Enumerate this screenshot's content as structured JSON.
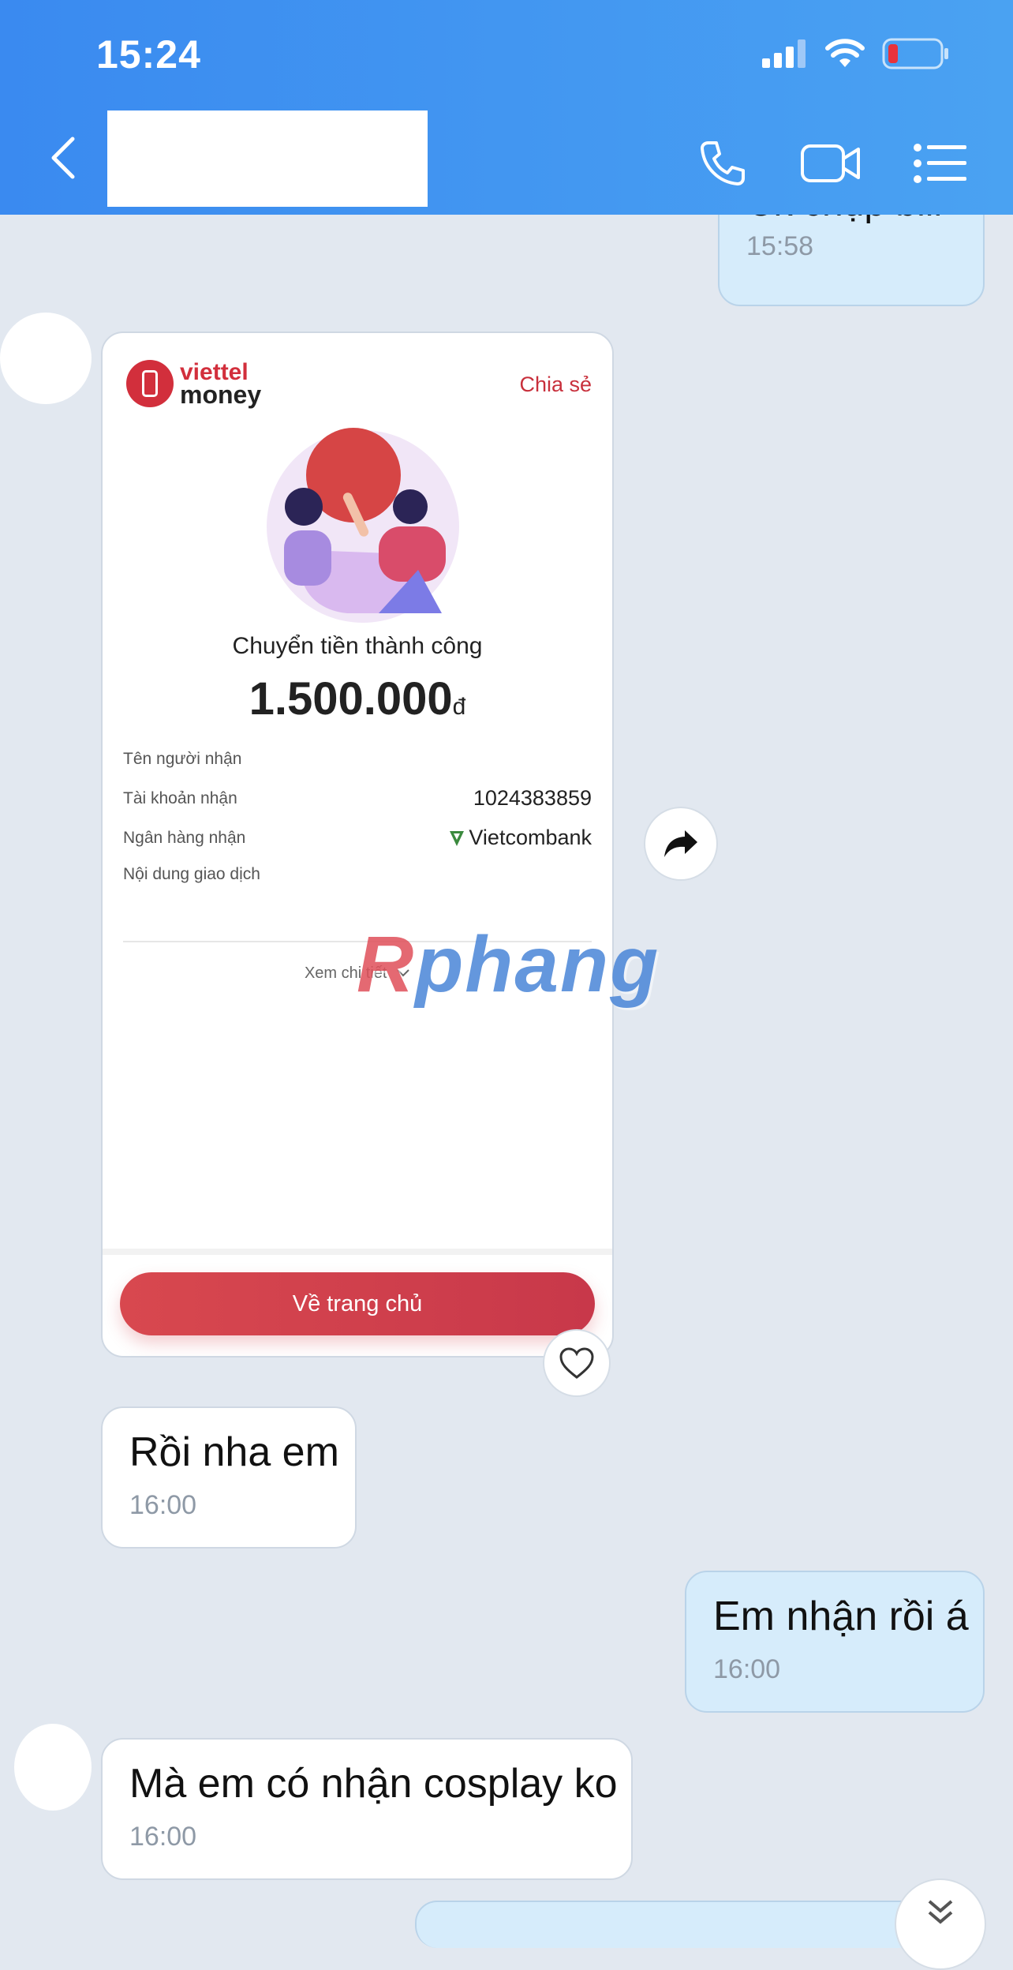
{
  "status_bar": {
    "time": "15:24"
  },
  "prev_message": {
    "text": "Ck chụp bill",
    "time": "15:58"
  },
  "receipt": {
    "brand_line1": "viettel",
    "brand_line2": "money",
    "share_label": "Chia sẻ",
    "success_text": "Chuyển tiền thành công",
    "amount": "1.500.000",
    "currency": "đ",
    "fields": [
      {
        "label": "Tên người nhận",
        "value": ""
      },
      {
        "label": "Tài khoản nhận",
        "value": "1024383859"
      },
      {
        "label": "Ngân hàng nhận",
        "value": "Vietcombank"
      },
      {
        "label": "Nội dung giao dịch",
        "value": ""
      }
    ],
    "detail_link": "Xem chi tiết",
    "home_button": "Về trang chủ"
  },
  "watermark": {
    "first": "R",
    "rest": "phang"
  },
  "messages": [
    {
      "text": "Rồi nha em",
      "time": "16:00",
      "direction": "in"
    },
    {
      "text": "Em nhận rồi á",
      "time": "16:00",
      "direction": "out"
    },
    {
      "text": "Mà em có nhận cosplay ko",
      "time": "16:00",
      "direction": "in"
    }
  ],
  "colors": {
    "header": "#3a8af0",
    "outgoing": "#d6ecfb",
    "incoming": "#ffffff",
    "brand": "#d22f3c"
  }
}
